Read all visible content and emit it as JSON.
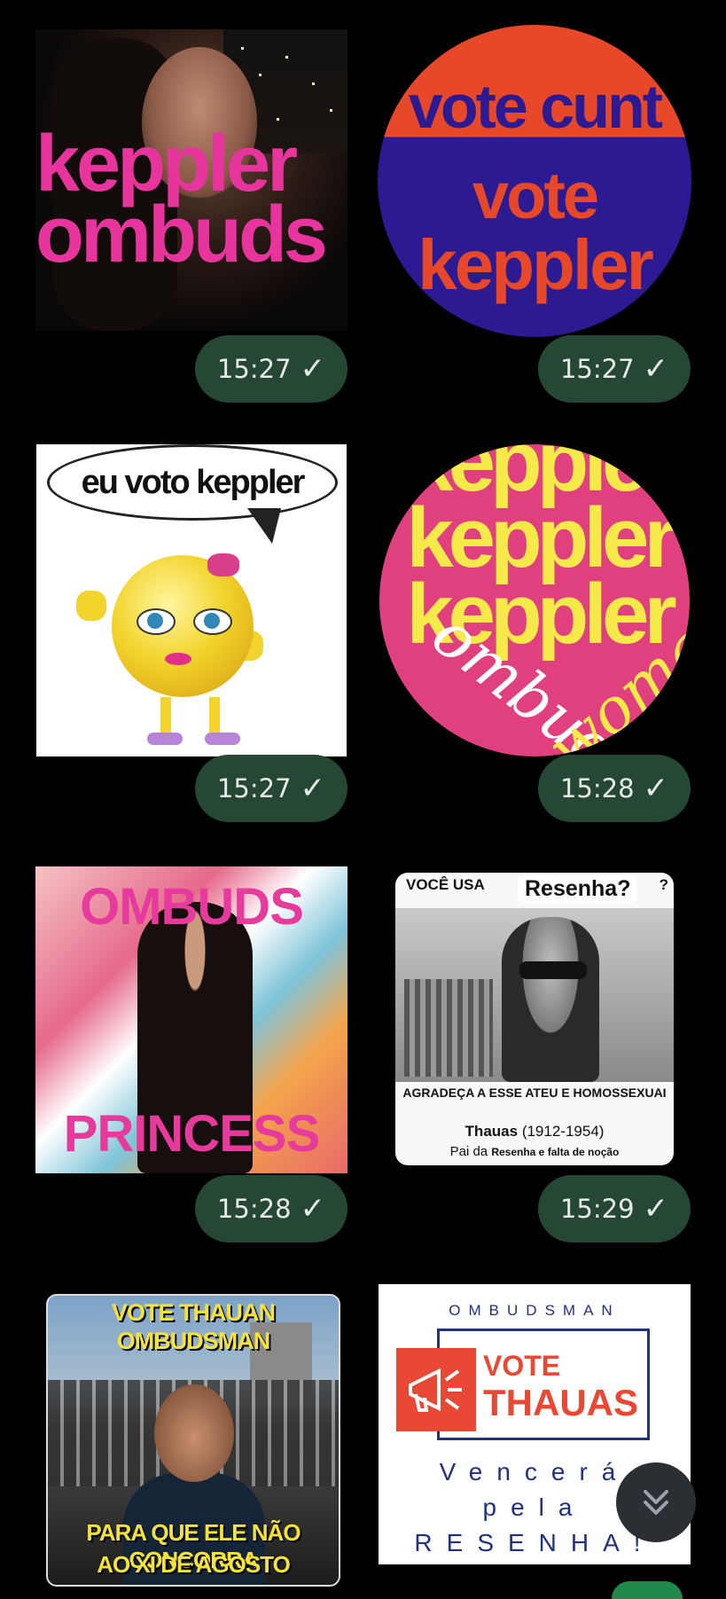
{
  "stickers": [
    {
      "id": 1,
      "lines": [
        "keppler",
        "ombuds"
      ],
      "time": "15:27"
    },
    {
      "id": 2,
      "lines": [
        "vote cunt",
        "vote",
        "keppler"
      ],
      "time": "15:27"
    },
    {
      "id": 3,
      "lines": [
        "eu voto keppler"
      ],
      "time": "15:27"
    },
    {
      "id": 4,
      "lines": [
        "keppler",
        "ombuds",
        "woman"
      ],
      "time": "15:28"
    },
    {
      "id": 5,
      "lines": [
        "OMBUDS",
        "PRINCESS"
      ],
      "time": "15:28"
    },
    {
      "id": 6,
      "lines": [
        "VOCÊ USA",
        "Resenha?",
        "?",
        "AGRADEÇA A ESSE ATEU E HOMOSSEXUAI",
        "Thauas",
        "(1912-1954)",
        "Pai da",
        "Resenha e falta de noção"
      ],
      "time": "15:29"
    },
    {
      "id": 7,
      "lines": [
        "VOTE THAUAN",
        "OMBUDSMAN",
        "PARA QUE ELE NÃO CONCORRA",
        "AO XI DE AGOSTO"
      ]
    },
    {
      "id": 8,
      "lines": [
        "OMBUDSMAN",
        "VOTE",
        "THAUAS",
        "Vencerá",
        "pela",
        "RESENHA!"
      ]
    }
  ],
  "read_check": "✓",
  "scroll_icon": "double-chevron-down-icon",
  "colors": {
    "background": "#000000",
    "time_bubble": "#254733",
    "scroll_button": "#2a2f33"
  }
}
